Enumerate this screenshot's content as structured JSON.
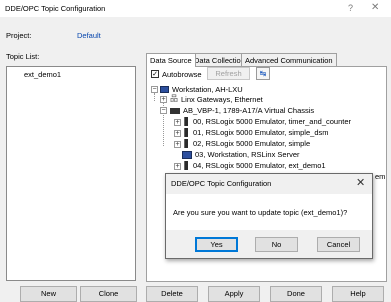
{
  "window": {
    "title": "DDE/OPC Topic Configuration",
    "help": "?",
    "close": "✕"
  },
  "project": {
    "label": "Project:",
    "value": "Default"
  },
  "topic_list": {
    "label": "Topic List:",
    "items": [
      "ext_demo1"
    ]
  },
  "tabs": [
    {
      "label": "Data Source",
      "active": true
    },
    {
      "label": "Data Collection",
      "active": false
    },
    {
      "label": "Advanced Communication",
      "active": false
    }
  ],
  "toolbar": {
    "autobrowse_label": "Autobrowse",
    "autobrowse_checked": "✓",
    "refresh_label": "Refresh",
    "config_icon": "↹"
  },
  "tree": {
    "workstation": "Workstation, AH-LXU",
    "linx_gateways": "Linx Gateways, Ethernet",
    "chassis": "AB_VBP-1, 1789-A17/A Virtual Chassis",
    "modules": [
      "00, RSLogix 5000 Emulator, timer_and_counter",
      "01, RSLogix 5000 Emulator, simple_dsm",
      "02, RSLogix 5000 Emulator, simple",
      "03, Workstation, RSLinx Server",
      "04, RSLogix 5000 Emulator, ext_demo1"
    ],
    "clipped_fragment": "em",
    "expand_minus": "−",
    "expand_plus": "+"
  },
  "dialog": {
    "title": "DDE/OPC Topic Configuration",
    "close": "✕",
    "message": "Are you sure you want to update topic (ext_demo1)?",
    "yes": "Yes",
    "no": "No",
    "cancel": "Cancel"
  },
  "buttons": {
    "new": "New",
    "clone": "Clone",
    "delete": "Delete",
    "apply": "Apply",
    "done": "Done",
    "help": "Help"
  }
}
